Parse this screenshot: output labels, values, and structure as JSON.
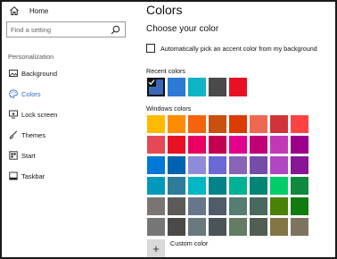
{
  "sidebar": {
    "home_label": "Home",
    "search_placeholder": "Find a setting",
    "section_label": "Personalization",
    "items": [
      {
        "label": "Background",
        "icon": "picture-icon"
      },
      {
        "label": "Colors",
        "icon": "palette-icon"
      },
      {
        "label": "Lock screen",
        "icon": "monitor-lock-icon"
      },
      {
        "label": "Themes",
        "icon": "brush-icon"
      },
      {
        "label": "Start",
        "icon": "start-icon"
      },
      {
        "label": "Taskbar",
        "icon": "taskbar-icon"
      }
    ],
    "active_index": 1
  },
  "main": {
    "title": "Colors",
    "subtitle": "Choose your color",
    "auto_pick_label": "Automatically pick an accent color from my background",
    "auto_pick_checked": false,
    "recent_label": "Recent colors",
    "recent_colors": [
      "#3a67b8",
      "#2d79d6",
      "#0fb5c4",
      "#4a4a4a",
      "#e81123"
    ],
    "recent_selected_index": 0,
    "windows_label": "Windows colors",
    "windows_colors": [
      [
        "#ffb900",
        "#ff8c00",
        "#f7630c",
        "#ca5010",
        "#da3b01",
        "#ef6950",
        "#d13438",
        "#ff4343"
      ],
      [
        "#e74856",
        "#e81123",
        "#ea005e",
        "#c30052",
        "#e3008c",
        "#bf0077",
        "#c239b3",
        "#9a0089"
      ],
      [
        "#0078d7",
        "#0063b1",
        "#8e8cd8",
        "#6b69d6",
        "#8764b8",
        "#744da9",
        "#b146c2",
        "#881798"
      ],
      [
        "#0099bc",
        "#2d7d9a",
        "#00b7c3",
        "#038387",
        "#00b294",
        "#018574",
        "#00cc6a",
        "#10893e"
      ],
      [
        "#7a7574",
        "#5d5a58",
        "#68768a",
        "#515c6b",
        "#567c73",
        "#486860",
        "#498205",
        "#107c10"
      ],
      [
        "#767676",
        "#4c4a48",
        "#69797e",
        "#4a5459",
        "#647c64",
        "#525e54",
        "#847545",
        "#7e735f"
      ]
    ],
    "custom_label": "Custom color"
  },
  "colors": {
    "accent": "#2b6ec0",
    "border": "#1a1a1a"
  }
}
